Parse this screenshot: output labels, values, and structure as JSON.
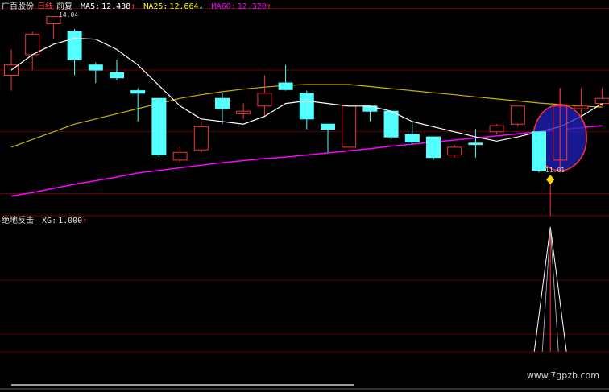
{
  "header_main": {
    "stock": "广百股份",
    "period": "日线",
    "adjust": "前复",
    "ma5_label": "MA5:",
    "ma5_value": "12.438",
    "ma5_arrow": "↑",
    "ma25_label": "MA25:",
    "ma25_value": "12.664",
    "ma25_arrow": "↓",
    "ma60_label": "MA60:",
    "ma60_value": "12.320",
    "ma60_arrow": "↑"
  },
  "header_sub": {
    "indicator": "绝地反击",
    "xg_label": "XG:",
    "xg_value": "1.000",
    "xg_arrow": "↑"
  },
  "watermark": "www.7gpzb.com",
  "colors": {
    "background": "#000000",
    "up": "#ff3232",
    "down": "#54ffff",
    "ma5": "#ffffff",
    "ma25": "#c8b400",
    "ma60": "#ff00ff",
    "divider": "#800000",
    "highlight_circle": "#2020c0",
    "signal_marker": "#ffd700"
  },
  "chart_data": [
    {
      "type": "candlestick",
      "title": "广百股份 日线",
      "peak_label": "14.04",
      "low_label": "11.01",
      "candles": [
        {
          "open": 12.9,
          "close": 13.1,
          "high": 13.4,
          "low": 12.6
        },
        {
          "open": 13.3,
          "close": 13.7,
          "high": 13.75,
          "low": 13.0
        },
        {
          "open": 13.9,
          "close": 14.04,
          "high": 14.04,
          "low": 13.6
        },
        {
          "open": 13.75,
          "close": 13.2,
          "high": 13.8,
          "low": 12.9
        },
        {
          "open": 13.1,
          "close": 13.0,
          "high": 13.15,
          "low": 12.75
        },
        {
          "open": 12.95,
          "close": 12.85,
          "high": 13.2,
          "low": 12.8
        },
        {
          "open": 12.6,
          "close": 12.55,
          "high": 12.65,
          "low": 12.0
        },
        {
          "open": 12.45,
          "close": 11.35,
          "high": 12.45,
          "low": 11.3
        },
        {
          "open": 11.25,
          "close": 11.4,
          "high": 11.5,
          "low": 11.2
        },
        {
          "open": 11.45,
          "close": 11.9,
          "high": 12.0,
          "low": 11.4
        },
        {
          "open": 12.45,
          "close": 12.25,
          "high": 12.55,
          "low": 11.95
        },
        {
          "open": 12.15,
          "close": 12.2,
          "high": 12.35,
          "low": 12.05
        },
        {
          "open": 12.3,
          "close": 12.55,
          "high": 12.9,
          "low": 12.1
        },
        {
          "open": 12.75,
          "close": 12.62,
          "high": 13.1,
          "low": 12.6
        },
        {
          "open": 12.55,
          "close": 12.05,
          "high": 12.6,
          "low": 11.85
        },
        {
          "open": 11.95,
          "close": 11.85,
          "high": 11.95,
          "low": 11.4
        },
        {
          "open": 11.5,
          "close": 12.3,
          "high": 12.3,
          "low": 11.5
        },
        {
          "open": 12.3,
          "close": 12.2,
          "high": 12.3,
          "low": 12.0
        },
        {
          "open": 12.2,
          "close": 11.7,
          "high": 12.2,
          "low": 11.65
        },
        {
          "open": 11.75,
          "close": 11.6,
          "high": 12.0,
          "low": 11.55
        },
        {
          "open": 11.7,
          "close": 11.3,
          "high": 11.7,
          "low": 11.25
        },
        {
          "open": 11.35,
          "close": 11.5,
          "high": 11.55,
          "low": 11.3
        },
        {
          "open": 11.58,
          "close": 11.55,
          "high": 11.85,
          "low": 11.3
        },
        {
          "open": 11.8,
          "close": 11.92,
          "high": 11.95,
          "low": 11.75
        },
        {
          "open": 11.95,
          "close": 12.3,
          "high": 12.3,
          "low": 11.9
        },
        {
          "open": 11.8,
          "close": 11.05,
          "high": 11.8,
          "low": 11.01
        },
        {
          "open": 11.25,
          "close": 12.3,
          "high": 12.65,
          "low": 11.01
        },
        {
          "open": 12.25,
          "close": 12.3,
          "high": 12.65,
          "low": 12.0
        },
        {
          "open": 12.35,
          "close": 12.45,
          "high": 12.65,
          "low": 12.3
        }
      ],
      "ma5": [
        13.0,
        13.3,
        13.5,
        13.62,
        13.6,
        13.4,
        13.1,
        12.7,
        12.3,
        12.05,
        12.0,
        11.95,
        12.1,
        12.35,
        12.4,
        12.35,
        12.3,
        12.3,
        12.2,
        12.0,
        11.9,
        11.8,
        11.7,
        11.62,
        11.7,
        11.8,
        11.9,
        12.1,
        12.35
      ],
      "ma25": [
        11.5,
        11.65,
        11.8,
        11.95,
        12.05,
        12.15,
        12.25,
        12.35,
        12.45,
        12.52,
        12.58,
        12.63,
        12.67,
        12.7,
        12.72,
        12.72,
        12.72,
        12.68,
        12.64,
        12.6,
        12.56,
        12.52,
        12.48,
        12.44,
        12.4,
        12.36,
        12.33,
        12.3,
        12.28
      ],
      "ma60": [
        10.55,
        10.62,
        10.7,
        10.78,
        10.85,
        10.92,
        11.0,
        11.05,
        11.1,
        11.15,
        11.2,
        11.24,
        11.28,
        11.31,
        11.35,
        11.39,
        11.43,
        11.47,
        11.52,
        11.56,
        11.6,
        11.64,
        11.68,
        11.72,
        11.76,
        11.8,
        11.84,
        11.88,
        11.92
      ],
      "ylim": [
        10.2,
        14.3
      ],
      "grid": true
    },
    {
      "type": "line",
      "title": "绝地反击",
      "series": [
        {
          "name": "XG",
          "values": [
            0,
            0,
            0,
            0,
            0,
            0,
            0,
            0,
            0,
            0,
            0,
            0,
            0,
            0,
            0,
            0,
            0,
            0,
            0,
            0,
            0,
            0,
            0,
            0,
            0,
            0,
            1,
            0,
            0
          ]
        }
      ],
      "ylim": [
        0,
        1
      ]
    }
  ]
}
